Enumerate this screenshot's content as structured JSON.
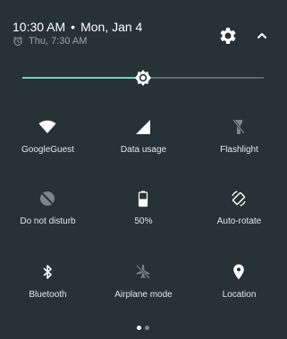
{
  "header": {
    "time": "10:30 AM",
    "separator": "•",
    "date": "Mon, Jan 4",
    "alarm_text": "Thu, 7:30 AM",
    "settings_icon": "gear-icon",
    "expand_icon": "chevron-up-icon"
  },
  "brightness": {
    "level": 0.5,
    "icon": "brightness-icon"
  },
  "tiles": [
    {
      "label": "GoogleGuest",
      "icon": "wifi-icon",
      "active": true
    },
    {
      "label": "Data usage",
      "icon": "cellular-signal-icon",
      "active": true
    },
    {
      "label": "Flashlight",
      "icon": "flashlight-icon",
      "active": false
    },
    {
      "label": "Do not disturb",
      "icon": "do-not-disturb-icon",
      "active": false
    },
    {
      "label": "50%",
      "icon": "battery-icon",
      "active": true
    },
    {
      "label": "Auto-rotate",
      "icon": "auto-rotate-icon",
      "active": true
    },
    {
      "label": "Bluetooth",
      "icon": "bluetooth-icon",
      "active": true
    },
    {
      "label": "Airplane mode",
      "icon": "airplane-icon",
      "active": false
    },
    {
      "label": "Location",
      "icon": "location-icon",
      "active": true
    }
  ],
  "pager": {
    "pages": 2,
    "current": 1
  },
  "colors": {
    "background": "#263238",
    "accent": "#7fcbc4",
    "icon_active": "#ffffff",
    "icon_inactive": "#7a868b"
  }
}
